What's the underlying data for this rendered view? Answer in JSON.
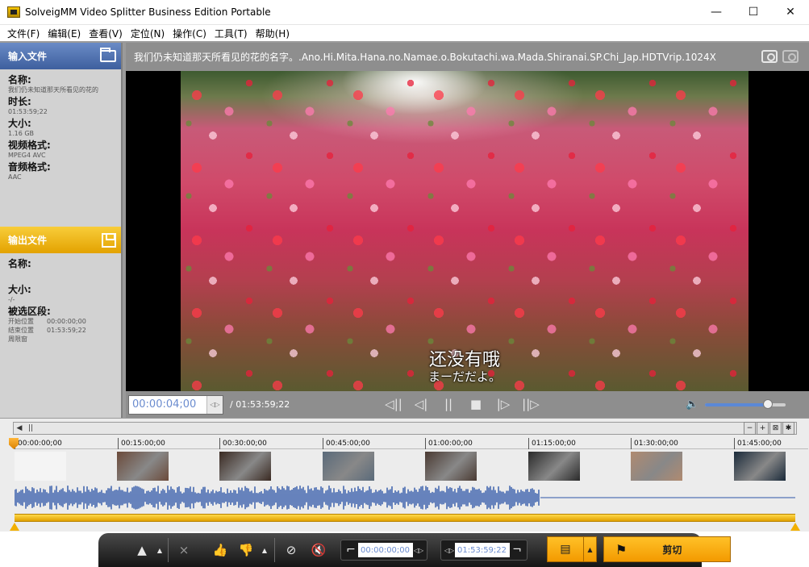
{
  "window": {
    "title": "SolveigMM Video Splitter Business Edition Portable",
    "minimize": "—",
    "maximize": "☐",
    "close": "✕"
  },
  "menu": [
    "文件(F)",
    "编辑(E)",
    "查看(V)",
    "定位(N)",
    "操作(C)",
    "工具(T)",
    "帮助(H)"
  ],
  "input_panel": {
    "header": "输入文件",
    "name_label": "名称:",
    "name_value": "我们仍未知道那天所看见的花的",
    "duration_label": "时长:",
    "duration_value": "01:53:59;22",
    "size_label": "大小:",
    "size_value": "1.16 GB",
    "video_label": "视频格式:",
    "video_value": "MPEG4 AVC",
    "audio_label": "音频格式:",
    "audio_value": "AAC"
  },
  "output_panel": {
    "header": "输出文件",
    "name_label": "名称:",
    "name_value": "",
    "size_label": "大小:",
    "size_value": "-/-",
    "selection_label": "被选区段:",
    "start_label": "开始位置",
    "start_value": "00:00:00;00",
    "end_label": "结束位置",
    "end_value": "01:53:59;22",
    "length_label": "周限窗"
  },
  "video": {
    "filename": "我们仍未知道那天所看见的花的名字。.Ano.Hi.Mita.Hana.no.Namae.o.Bokutachi.wa.Mada.Shiranai.SP.Chi_Jap.HDTVrip.1024X",
    "subtitle_cn": "还没有哦",
    "subtitle_jp": "まーだだよ。",
    "current_time": "00:00:04;00",
    "duration": "/ 01:53:59;22",
    "volume": 0.78
  },
  "transport": {
    "prev_mark": "◁||",
    "prev_frame": "◁|",
    "pause": "||",
    "stop": "■",
    "next_frame": "|▷",
    "next_mark": "||▷",
    "volume_icon": "🔈"
  },
  "timeline": {
    "ticks": [
      "00:00:00;00",
      "00:15:00;00",
      "00:30:00;00",
      "00:45:00;00",
      "01:00:00;00",
      "01:15:00;00",
      "01:30:00;00",
      "01:45:00;00"
    ],
    "thumb_colors": [
      "#f4f4f4",
      "#6b4a3a",
      "#3a2a22",
      "#5a6a7a",
      "#4a3a32",
      "#2a2a2a",
      "#b08a70",
      "#1a2a3a"
    ],
    "waveform_color": "#2e56a8"
  },
  "toolbar": {
    "start_time": "00:00:00;00",
    "end_time": "01:53:59;22",
    "cut_label": "剪切"
  }
}
